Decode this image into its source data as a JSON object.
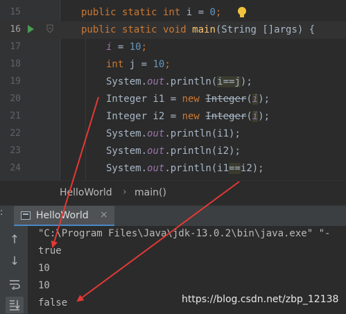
{
  "editor": {
    "lines": [
      {
        "num": "15",
        "tokens": [
          {
            "t": "public static int ",
            "c": "kw"
          },
          {
            "t": "i",
            "c": "plain"
          },
          {
            "t": " = ",
            "c": "plain"
          },
          {
            "t": "0",
            "c": "num"
          },
          {
            "t": ";",
            "c": "kw"
          }
        ]
      },
      {
        "num": "16",
        "tokens": [
          {
            "t": "public static void ",
            "c": "kw"
          },
          {
            "t": "main",
            "c": "fn"
          },
          {
            "t": "(String []args) {",
            "c": "plain"
          }
        ]
      },
      {
        "num": "17",
        "tokens": [
          {
            "t": "i",
            "c": "fld"
          },
          {
            "t": " = ",
            "c": "plain"
          },
          {
            "t": "10",
            "c": "num"
          },
          {
            "t": ";",
            "c": "kw"
          }
        ]
      },
      {
        "num": "18",
        "tokens": [
          {
            "t": "int ",
            "c": "kw"
          },
          {
            "t": "j",
            "c": "plain"
          },
          {
            "t": " = ",
            "c": "plain"
          },
          {
            "t": "10",
            "c": "num"
          },
          {
            "t": ";",
            "c": "kw"
          }
        ]
      },
      {
        "num": "19",
        "tokens": [
          {
            "t": "System.",
            "c": "plain"
          },
          {
            "t": "out",
            "c": "fld"
          },
          {
            "t": ".println(",
            "c": "plain"
          },
          {
            "t": "i==j",
            "c": "hl"
          },
          {
            "t": ");",
            "c": "plain"
          }
        ]
      },
      {
        "num": "20",
        "tokens": [
          {
            "t": "Integer i1 = ",
            "c": "plain"
          },
          {
            "t": "new ",
            "c": "kw"
          },
          {
            "t": "Integer",
            "c": "strike"
          },
          {
            "t": "(",
            "c": "plain"
          },
          {
            "t": "i",
            "c": "fldhl"
          },
          {
            "t": ");",
            "c": "plain"
          }
        ]
      },
      {
        "num": "21",
        "tokens": [
          {
            "t": "Integer i2 = ",
            "c": "plain"
          },
          {
            "t": "new ",
            "c": "kw"
          },
          {
            "t": "Integer",
            "c": "strike"
          },
          {
            "t": "(",
            "c": "plain"
          },
          {
            "t": "i",
            "c": "fldhl"
          },
          {
            "t": ");",
            "c": "plain"
          }
        ]
      },
      {
        "num": "22",
        "tokens": [
          {
            "t": "System.",
            "c": "plain"
          },
          {
            "t": "out",
            "c": "fld"
          },
          {
            "t": ".println(i1);",
            "c": "plain"
          }
        ]
      },
      {
        "num": "23",
        "tokens": [
          {
            "t": "System.",
            "c": "plain"
          },
          {
            "t": "out",
            "c": "fld"
          },
          {
            "t": ".println(i2);",
            "c": "plain"
          }
        ]
      },
      {
        "num": "24",
        "tokens": [
          {
            "t": "System.",
            "c": "plain"
          },
          {
            "t": "out",
            "c": "fld"
          },
          {
            "t": ".println(i1",
            "c": "plain"
          },
          {
            "t": "==",
            "c": "hl"
          },
          {
            "t": "i2);",
            "c": "plain"
          }
        ]
      }
    ]
  },
  "breadcrumb": {
    "class_name": "HelloWorld",
    "method_name": "main()"
  },
  "run_window": {
    "tab_label": "HelloWorld",
    "close_symbol": "×",
    "console_lines": [
      "\"C:\\Program Files\\Java\\jdk-13.0.2\\bin\\java.exe\" \"-",
      "true",
      "10",
      "10",
      "false"
    ]
  },
  "watermark": "https://blog.csdn.net/zbp_12138",
  "icons": {
    "run": "run-gutter-icon",
    "bulb": "intention-bulb-icon",
    "up": "scroll-up-icon",
    "down": "scroll-down-icon",
    "wrap": "soft-wrap-icon",
    "scroll_end": "scroll-to-end-icon"
  },
  "colors": {
    "background": "#2b2b2b",
    "keyword": "#cc7832",
    "number": "#6897bb",
    "method": "#ffc66d",
    "field": "#9876aa",
    "arrow": "#e53935"
  }
}
